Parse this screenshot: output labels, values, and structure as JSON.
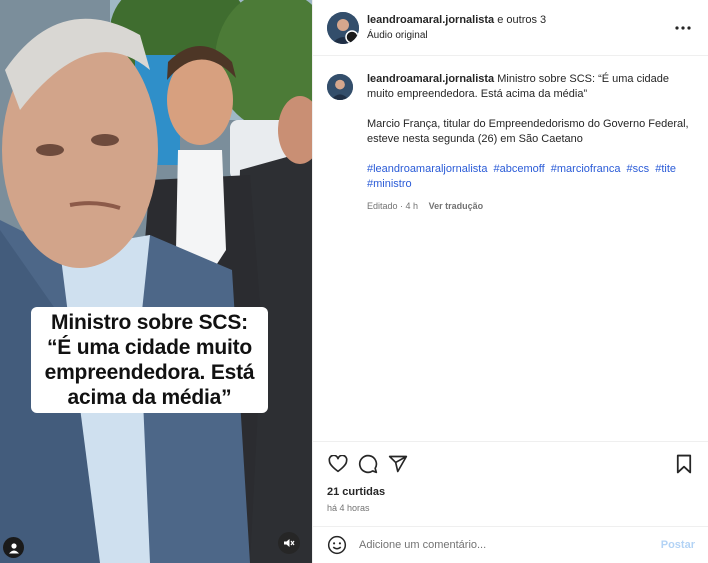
{
  "media": {
    "overlay_text": "Ministro sobre SCS:\n“É uma cidade muito empreendedora. Está acima da média”",
    "overlay_lines": [
      "Ministro sobre SCS:",
      "“É uma cidade muito",
      "empreendedora. Está",
      "acima da média”"
    ],
    "icons": {
      "user_tag": "person-icon",
      "mute": "speaker-muted-icon"
    }
  },
  "header": {
    "username": "leandroamaral.jornalista",
    "collab_text": "e outros 3",
    "audio_label": "Áudio original",
    "more_icon": "more-horizontal-icon"
  },
  "caption": {
    "username": "leandroamaral.jornalista",
    "text": "Ministro sobre SCS: “É uma cidade muito empreendedora. Está acima da média”",
    "paragraph": "Marcio França, titular do Empreendedorismo do Governo Federal, esteve nesta segunda (26) em São Caetano",
    "hashtags": [
      "#leandroamaraljornalista",
      "#abcemoff",
      "#marciofranca",
      "#scs",
      "#tite",
      "#ministro"
    ],
    "edited": "Editado · 4 h",
    "translate": "Ver tradução"
  },
  "actions": {
    "icons": [
      "heart-icon",
      "comment-icon",
      "share-icon",
      "bookmark-icon"
    ],
    "likes": "21 curtidas",
    "time": "há 4 horas"
  },
  "comment_box": {
    "placeholder": "Adicione um comentário...",
    "post_label": "Postar",
    "emoji_icon": "emoji-icon"
  },
  "colors": {
    "link": "#2a5bd7",
    "muted": "#737373",
    "post_disabled": "#b3d3f5"
  }
}
